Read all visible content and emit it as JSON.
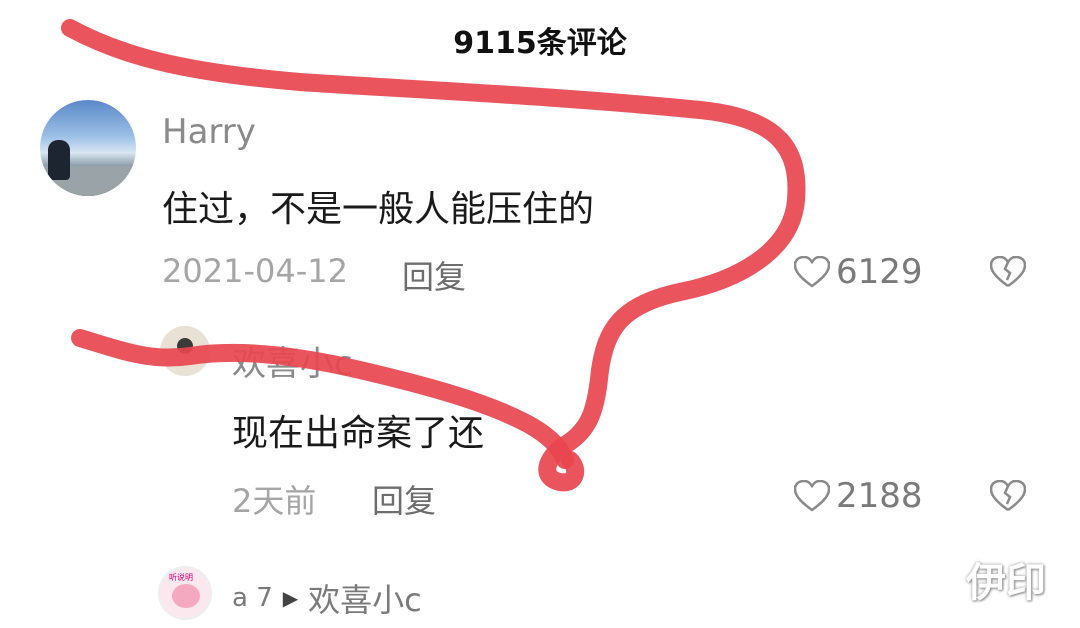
{
  "header": {
    "title": "9115条评论"
  },
  "comments": [
    {
      "username": "Harry",
      "text": "住过，不是一般人能压住的",
      "date": "2021-04-12",
      "reply_label": "回复",
      "likes": "6129"
    },
    {
      "username": "欢喜小c",
      "text": "现在出命案了还",
      "date": "2天前",
      "reply_label": "回复",
      "likes": "2188"
    }
  ],
  "sub_reply": {
    "username": "a 7",
    "reply_to": "欢喜小c",
    "avatar_text": "听说明"
  },
  "watermark": "伊印",
  "colors": {
    "scribble": "#e8454f",
    "like_icon": "#8a8a8a"
  }
}
